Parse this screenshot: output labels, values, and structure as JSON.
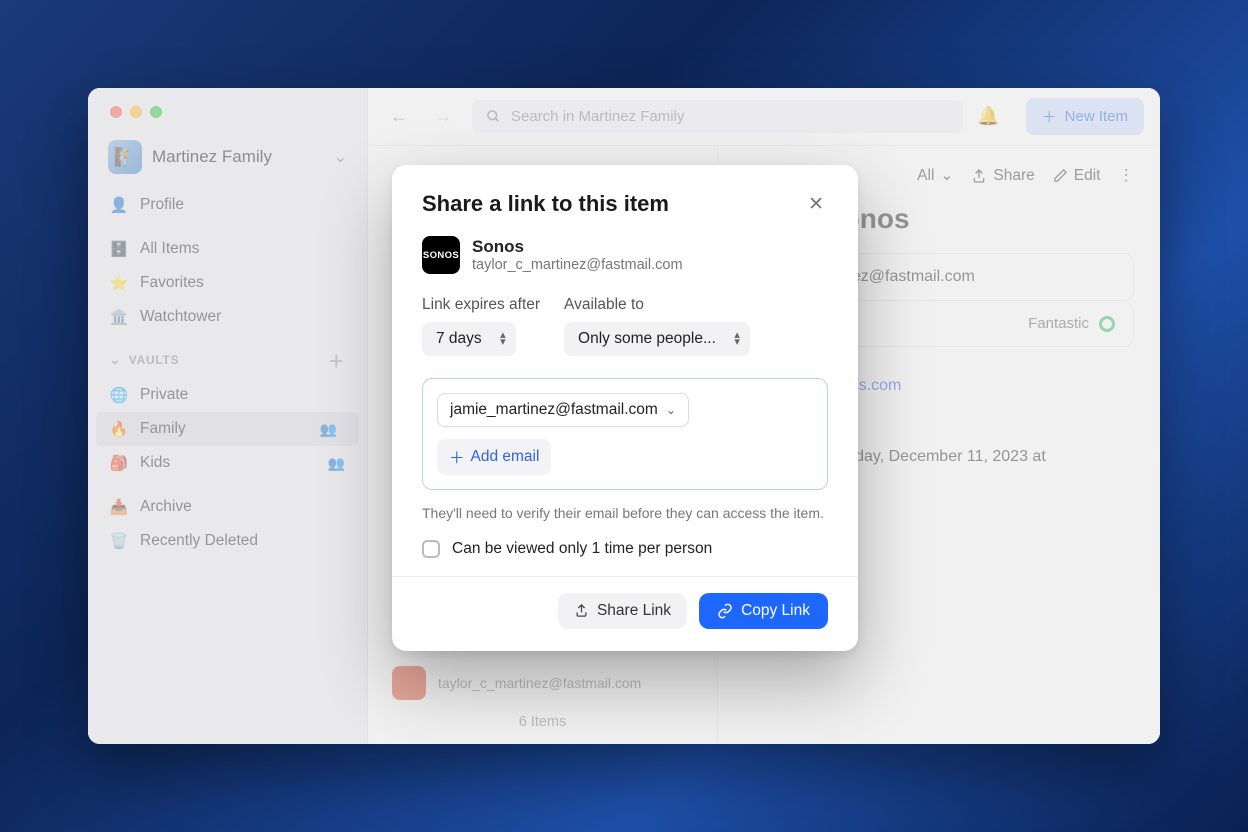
{
  "workspace": {
    "name": "Martinez Family"
  },
  "sidebar": {
    "profile": "Profile",
    "all_items": "All Items",
    "favorites": "Favorites",
    "watchtower": "Watchtower",
    "vaults_header": "VAULTS",
    "vaults": {
      "private": "Private",
      "family": "Family",
      "kids": "Kids"
    },
    "archive": "Archive",
    "recently_deleted": "Recently Deleted"
  },
  "topbar": {
    "search_placeholder": "Search in Martinez Family",
    "new_item": "New Item"
  },
  "detail_toolbar": {
    "all": "All",
    "share": "Share",
    "edit": "Edit"
  },
  "item": {
    "name": "Sonos",
    "username": "nez@fastmail.com",
    "strength": "Fantastic",
    "website": "sonos.com",
    "date": "Monday, December 11, 2023 at"
  },
  "list": {
    "bottom_email": "taylor_c_martinez@fastmail.com",
    "count": "6 Items"
  },
  "modal": {
    "title": "Share a link to this item",
    "item_name": "Sonos",
    "item_sub": "taylor_c_martinez@fastmail.com",
    "expires_label": "Link expires after",
    "expires_value": "7 days",
    "available_label": "Available to",
    "available_value": "Only some people...",
    "email_chip": "jamie_martinez@fastmail.com",
    "add_email": "Add email",
    "note": "They'll need to verify their email before they can access the item.",
    "once_label": "Can be viewed only 1 time per person",
    "share_link": "Share Link",
    "copy_link": "Copy Link"
  }
}
